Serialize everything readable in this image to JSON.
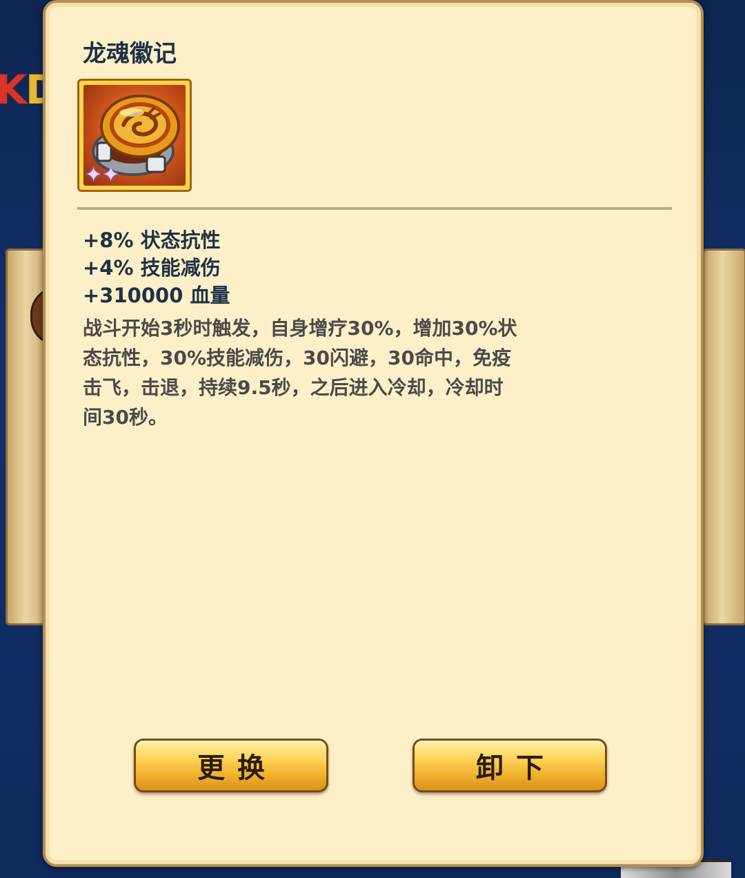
{
  "background": {
    "partial_text_prefix": "K",
    "partial_text_suffix": "D"
  },
  "item": {
    "name": "龙魂徽记",
    "icon": "dragon-emblem-ring-icon",
    "star_count": 2,
    "stars": [
      "✦",
      "✦"
    ]
  },
  "stats": [
    "+8% 状态抗性",
    "+4% 技能减伤",
    "+310000 血量"
  ],
  "description": "战斗开始3秒时触发，自身增疗30%，增加30%状态抗性，30%技能减伤，30闪避，30命中，免疫击飞，击退，持续9.5秒，之后进入冷却，冷却时间30秒。",
  "buttons": {
    "replace": "更换",
    "remove": "卸下"
  },
  "colors": {
    "panel_bg": "#fdf0c8",
    "title_text": "#1f3147",
    "description_text": "#4a4a4a",
    "button_gold": "#f0b02c"
  }
}
